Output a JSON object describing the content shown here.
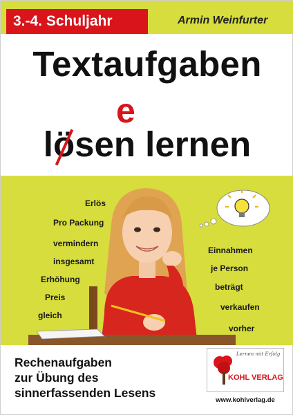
{
  "header": {
    "grade": "3.-4. Schuljahr",
    "author": "Armin Weinfurter"
  },
  "title": {
    "line1": "Textaufgaben",
    "line2_l": "l",
    "line2_o": "ö",
    "line2_rest": "sen lernen",
    "correction": "e"
  },
  "words_left": [
    "Erlös",
    "Pro Packung",
    "vermindern",
    "insgesamt",
    "Erhöhung",
    "Preis",
    "gleich"
  ],
  "words_right": [
    "Einnahmen",
    "je Person",
    "beträgt",
    "verkaufen",
    "vorher"
  ],
  "subtitle": [
    "Rechenaufgaben",
    "zur Übung des",
    "sinnerfassenden Lesens"
  ],
  "publisher": {
    "tagline": "Lernen mit Erfolg",
    "name": "KOHL VERLAG",
    "url": "www.kohlverlag.de"
  },
  "colors": {
    "accent_green": "#d6dd3c",
    "accent_red": "#d9141b"
  }
}
